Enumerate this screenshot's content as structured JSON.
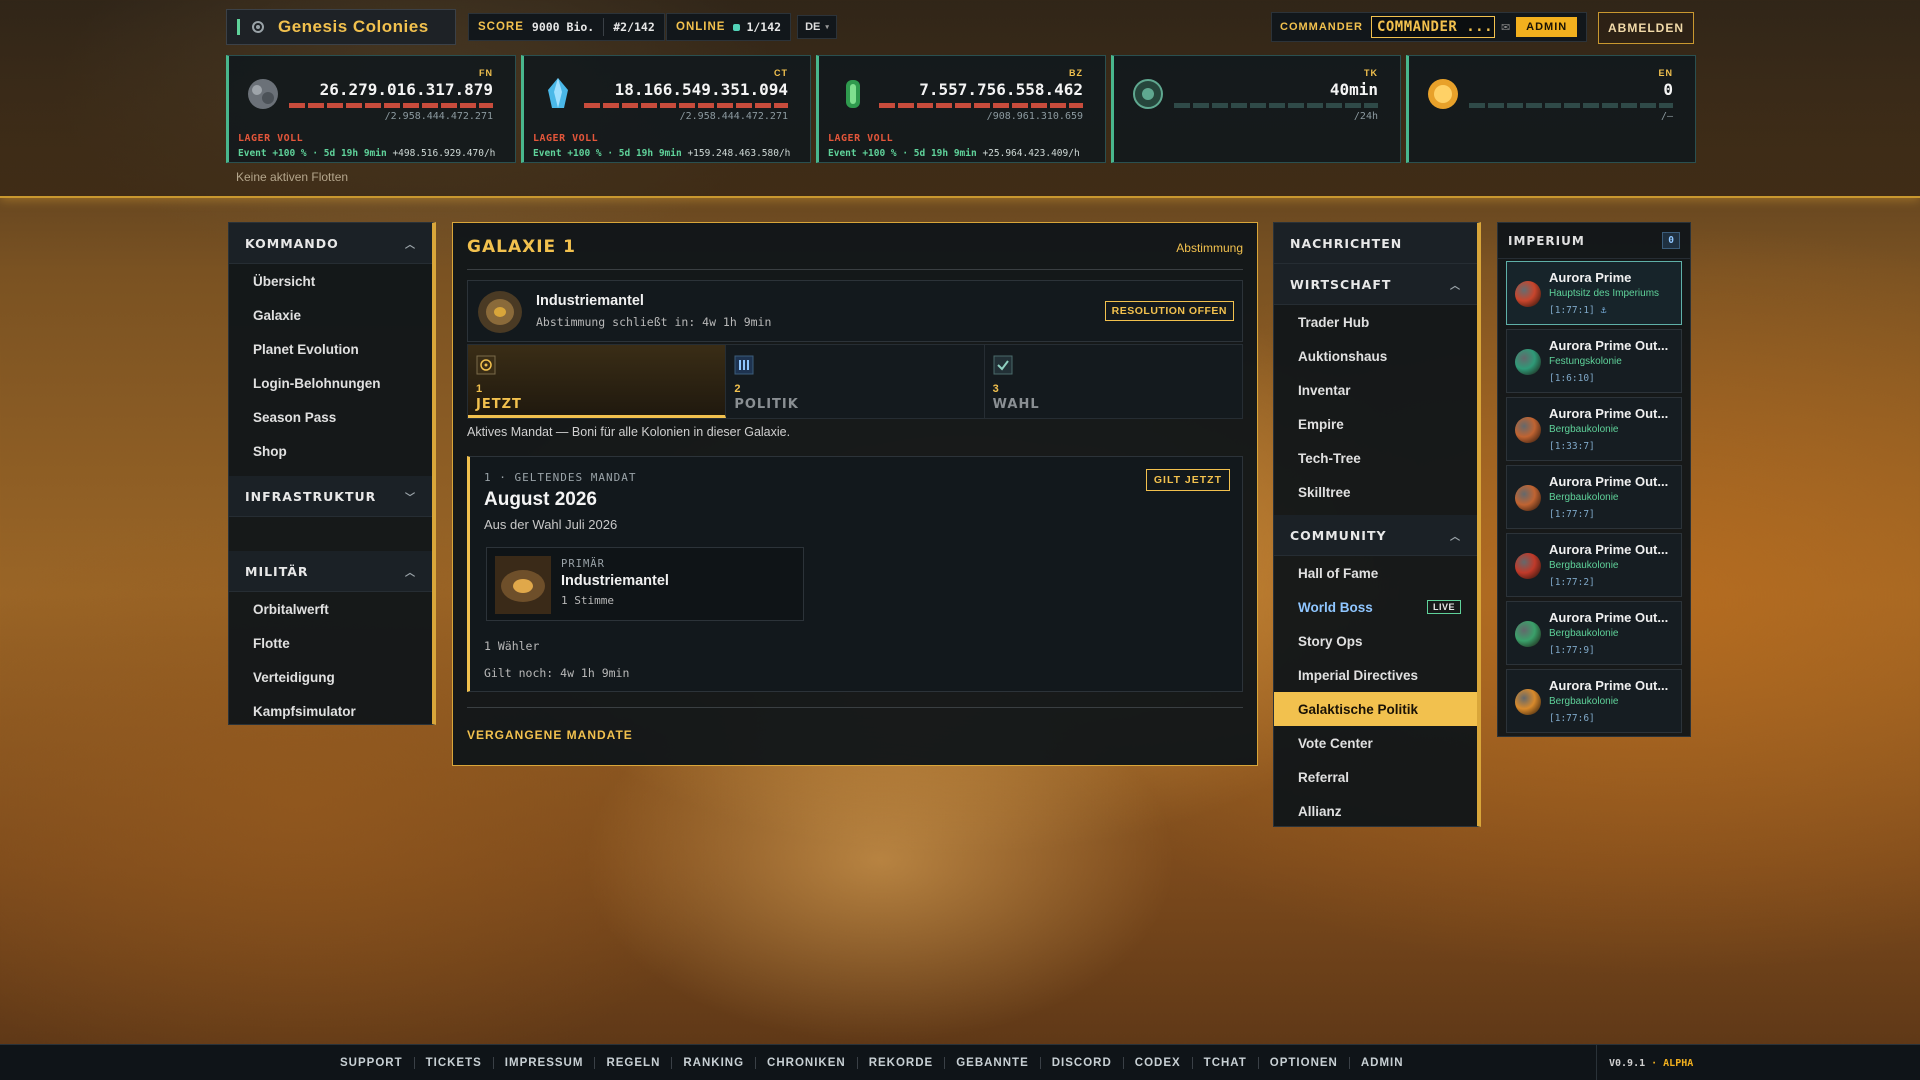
{
  "app": {
    "title": "Genesis Colonies"
  },
  "header": {
    "score_label": "SCORE",
    "score_value": "9000 Bio.",
    "rank": "#2/142",
    "online_label": "ONLINE",
    "online_value": "1/142",
    "language": "DE",
    "commander_label": "COMMANDER",
    "commander_name": "COMMANDER ...",
    "admin_badge": "ADMIN",
    "logout_label": "ABMELDEN"
  },
  "resources": [
    {
      "code": "FN",
      "amount": "26.279.016.317.879",
      "capacity": "/2.958.444.472.271",
      "status": "LAGER VOLL",
      "event": "Event +100 % · 5d 19h 9min",
      "rate": "+498.516.929.470/h",
      "icon": "ore-icon"
    },
    {
      "code": "CT",
      "amount": "18.166.549.351.094",
      "capacity": "/2.958.444.472.271",
      "status": "LAGER VOLL",
      "event": "Event +100 % · 5d 19h 9min",
      "rate": "+159.248.463.580/h",
      "icon": "crystal-icon"
    },
    {
      "code": "BZ",
      "amount": "7.557.756.558.462",
      "capacity": "/908.961.310.659",
      "status": "LAGER VOLL",
      "event": "Event +100 % · 5d 19h 9min",
      "rate": "+25.964.423.409/h",
      "icon": "fuel-icon"
    },
    {
      "code": "TK",
      "amount": "40min",
      "capacity": "/24h",
      "icon": "tk-icon"
    },
    {
      "code": "EN",
      "amount": "0",
      "capacity": "/—",
      "icon": "energy-icon"
    }
  ],
  "fleet_status": "Keine aktiven Flotten",
  "left_nav": {
    "sections": [
      {
        "title": "KOMMANDO",
        "items": [
          "Übersicht",
          "Galaxie",
          "Planet Evolution",
          "Login-Belohnungen",
          "Season Pass",
          "Shop"
        ]
      },
      {
        "title": "INFRASTRUKTUR",
        "items": []
      },
      {
        "title": "MILITÄR",
        "items": [
          "Orbitalwerft",
          "Flotte",
          "Verteidigung",
          "Kampfsimulator"
        ]
      }
    ]
  },
  "galaxie": {
    "title": "GALAXIE 1",
    "link": "Abstimmung",
    "resolution": {
      "name": "Industriemantel",
      "closes": "Abstimmung schließt in: 4w 1h 9min",
      "tag": "RESOLUTION OFFEN"
    },
    "tabs": [
      {
        "num": "1",
        "label": "JETZT"
      },
      {
        "num": "2",
        "label": "POLITIK"
      },
      {
        "num": "3",
        "label": "WAHL"
      }
    ],
    "description": "Aktives Mandat — Boni für alle Kolonien in dieser Galaxie.",
    "mandate": {
      "kicker": "1 · GELTENDES MANDAT",
      "title": "August 2026",
      "subtitle": "Aus der Wahl Juli 2026",
      "badge": "GILT JETZT",
      "primary_label": "PRIMÄR",
      "primary_name": "Industriemantel",
      "primary_votes": "1 Stimme",
      "voters": "1 Wähler",
      "remaining": "Gilt noch: 4w 1h 9min"
    },
    "past_label": "VERGANGENE MANDATE"
  },
  "right_nav": {
    "news": "NACHRICHTEN",
    "wirtschaft_title": "WIRTSCHAFT",
    "wirtschaft": [
      "Trader Hub",
      "Auktionshaus",
      "Inventar",
      "Empire",
      "Tech-Tree",
      "Skilltree"
    ],
    "community_title": "COMMUNITY",
    "community": [
      "Hall of Fame",
      "World Boss",
      "Story Ops",
      "Imperial Directives",
      "Galaktische Politik",
      "Vote Center",
      "Referral",
      "Allianz"
    ],
    "live_badge": "LIVE"
  },
  "imperium": {
    "title": "IMPERIUM",
    "count": "0",
    "planets": [
      {
        "name": "Aurora Prime",
        "type": "Hauptsitz des Imperiums",
        "coords": "[1:77:1]",
        "color": "#c8452c"
      },
      {
        "name": "Aurora Prime Out...",
        "type": "Festungskolonie",
        "coords": "[1:6:10]",
        "color": "#2f9a78"
      },
      {
        "name": "Aurora Prime Out...",
        "type": "Bergbaukolonie",
        "coords": "[1:33:7]",
        "color": "#c06432"
      },
      {
        "name": "Aurora Prime Out...",
        "type": "Bergbaukolonie",
        "coords": "[1:77:7]",
        "color": "#c06432"
      },
      {
        "name": "Aurora Prime Out...",
        "type": "Bergbaukolonie",
        "coords": "[1:77:2]",
        "color": "#c03a2a"
      },
      {
        "name": "Aurora Prime Out...",
        "type": "Bergbaukolonie",
        "coords": "[1:77:9]",
        "color": "#3aa06a"
      },
      {
        "name": "Aurora Prime Out...",
        "type": "Bergbaukolonie",
        "coords": "[1:77:6]",
        "color": "#d88a2c"
      }
    ]
  },
  "footer": {
    "links": [
      "SUPPORT",
      "TICKETS",
      "IMPRESSUM",
      "REGELN",
      "RANKING",
      "CHRONIKEN",
      "REKORDE",
      "GEBANNTE",
      "DISCORD",
      "CODEX",
      "TCHAT",
      "OPTIONEN",
      "ADMIN"
    ],
    "version": "V0.9.1",
    "stage": "· ALPHA"
  }
}
